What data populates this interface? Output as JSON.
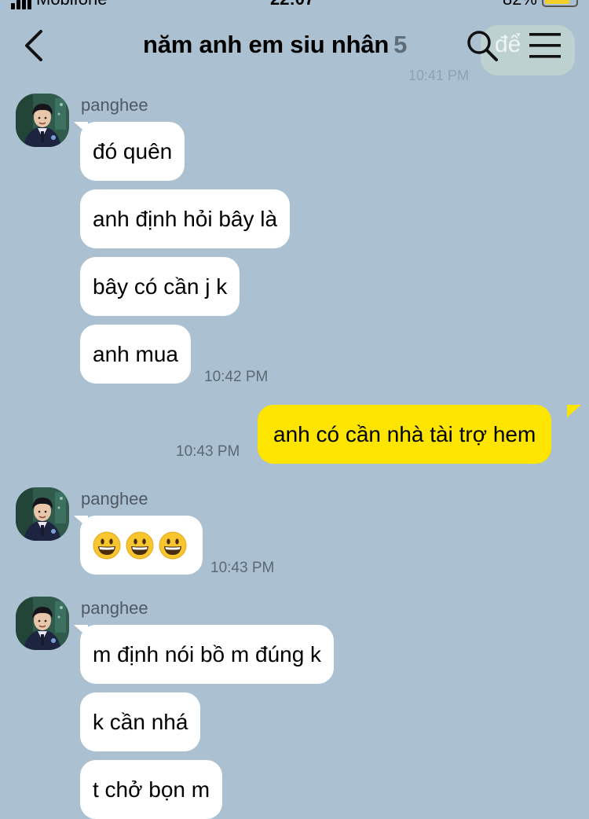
{
  "status_bar": {
    "carrier": "Mobifone",
    "time": "22:07",
    "battery": "82%"
  },
  "header": {
    "title": "năm anh em siu nhân",
    "member_count": "5",
    "ghost_message": "để",
    "ghost_time": "10:41 PM"
  },
  "messages": [
    {
      "sender": "panghee",
      "text": "đó quên"
    },
    {
      "text": "anh định hỏi bây là"
    },
    {
      "text": "bây có cần j k"
    },
    {
      "text": "anh mua",
      "time": "10:42 PM"
    },
    {
      "outgoing": true,
      "text": "anh có cần nhà tài trợ hem",
      "time": "10:43 PM"
    },
    {
      "sender": "panghee",
      "emoji": [
        "grinning-face",
        "grinning-face",
        "grinning-face"
      ],
      "time": "10:43 PM"
    },
    {
      "sender": "panghee",
      "text": "m định nói bồ m đúng k"
    },
    {
      "text": "k cần nhá"
    },
    {
      "text": "t chở bọn m"
    }
  ],
  "colors": {
    "background": "#abc1d1",
    "outgoing_bubble": "#fde500",
    "incoming_bubble": "#ffffff"
  }
}
